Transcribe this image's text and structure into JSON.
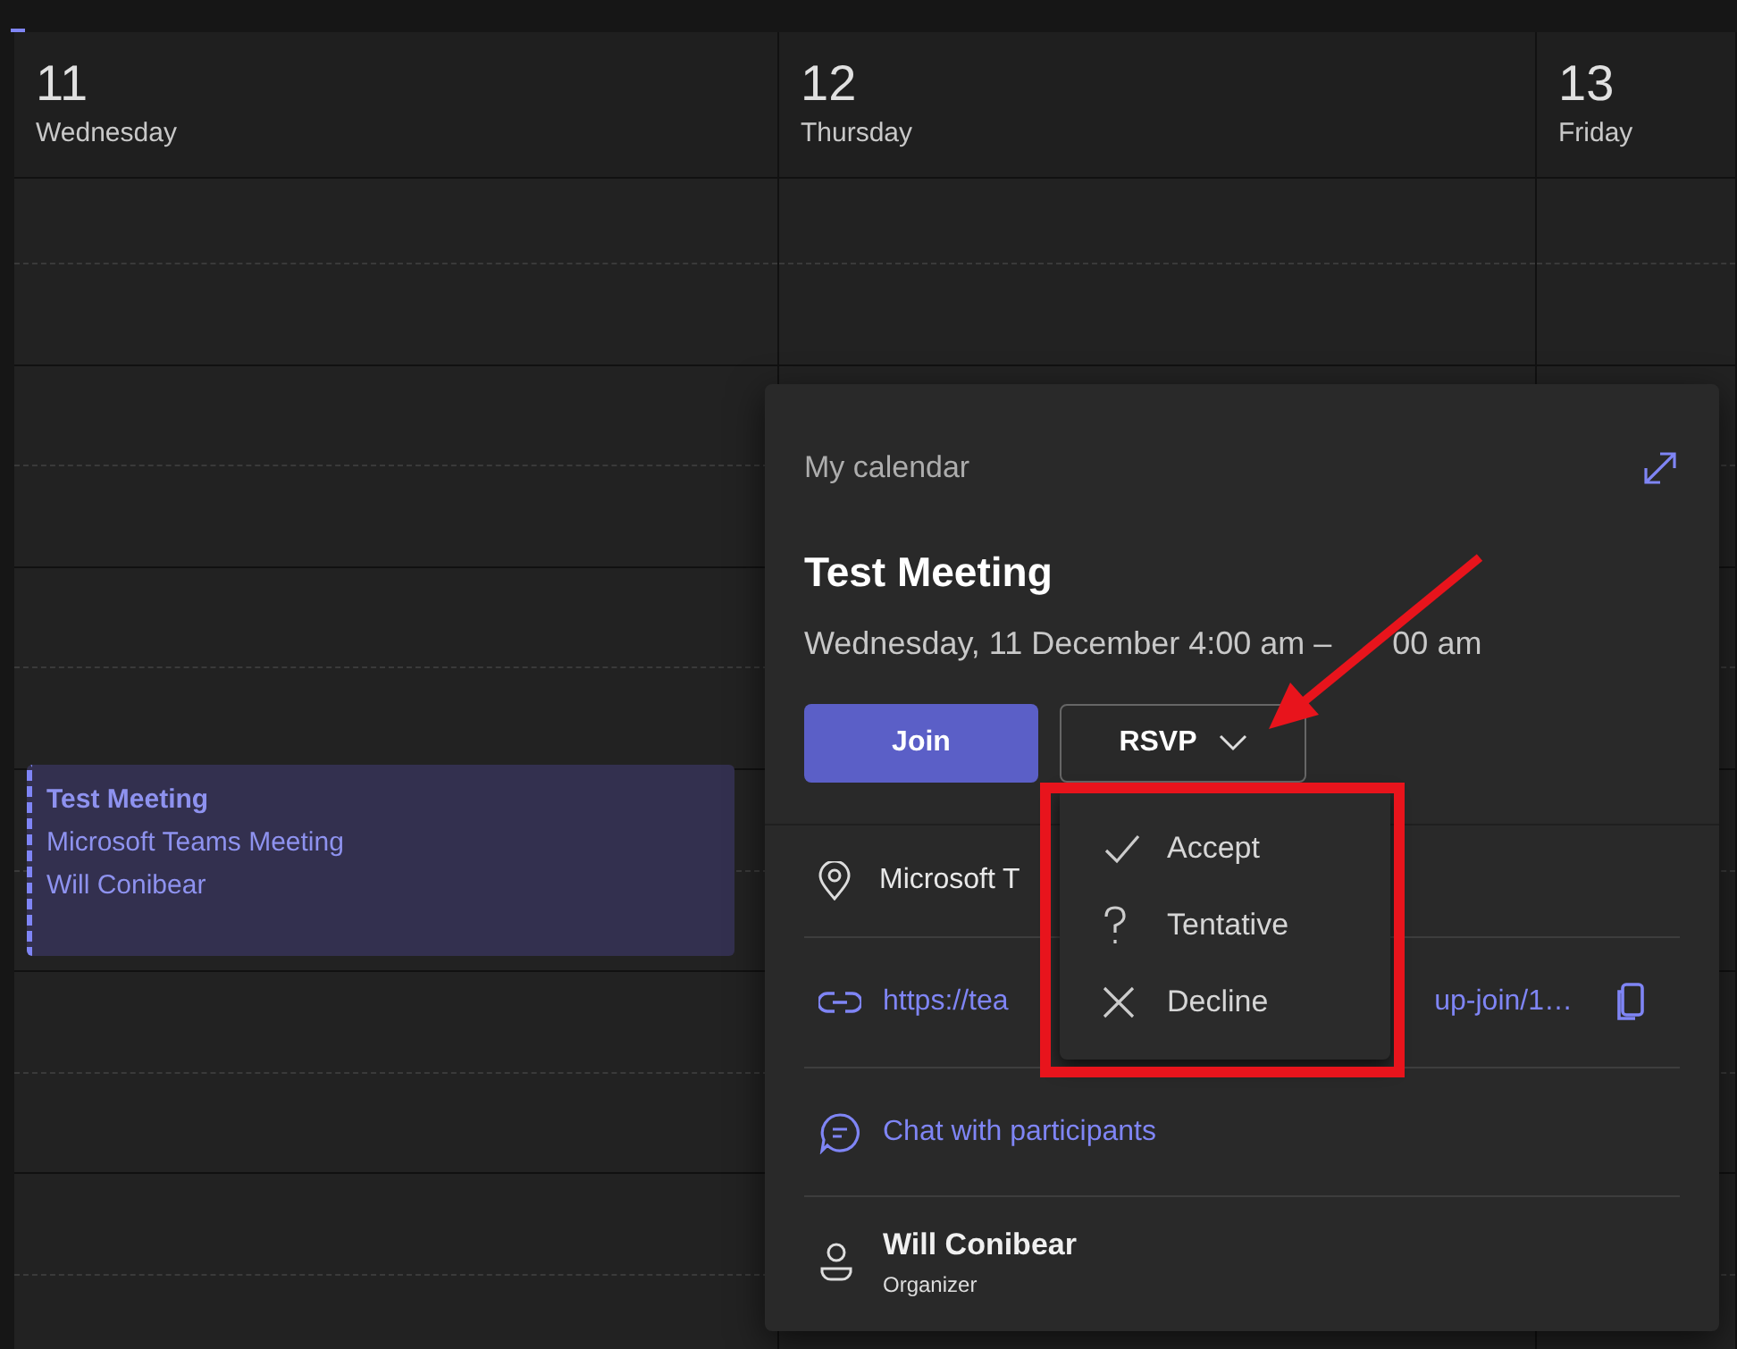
{
  "calendar": {
    "days": [
      {
        "number": "11",
        "weekday": "Wednesday",
        "events": [
          {
            "title": "Test Meeting",
            "lines": [
              "Microsoft Teams Meeting",
              "Will Conibear"
            ]
          }
        ]
      },
      {
        "number": "12",
        "weekday": "Thursday"
      },
      {
        "number": "13",
        "weekday": "Friday"
      }
    ]
  },
  "popup": {
    "calendar": "My calendar",
    "title": "Test Meeting",
    "time_start": "Wednesday, 11 December 4:00 am –",
    "time_end": "00 am",
    "join": "Join",
    "rsvp": {
      "label": "RSVP",
      "expanded": true
    },
    "rsvp_menu": [
      {
        "kind": "accept",
        "label": "Accept"
      },
      {
        "kind": "tentative",
        "label": "Tentative"
      },
      {
        "kind": "decline",
        "label": "Decline"
      }
    ],
    "location": "Microsoft T",
    "link": {
      "start": "https://tea",
      "end": "up-join/1…"
    },
    "chat": "Chat with participants",
    "organizer": {
      "name": "Will Conibear",
      "role": "Organizer"
    }
  }
}
